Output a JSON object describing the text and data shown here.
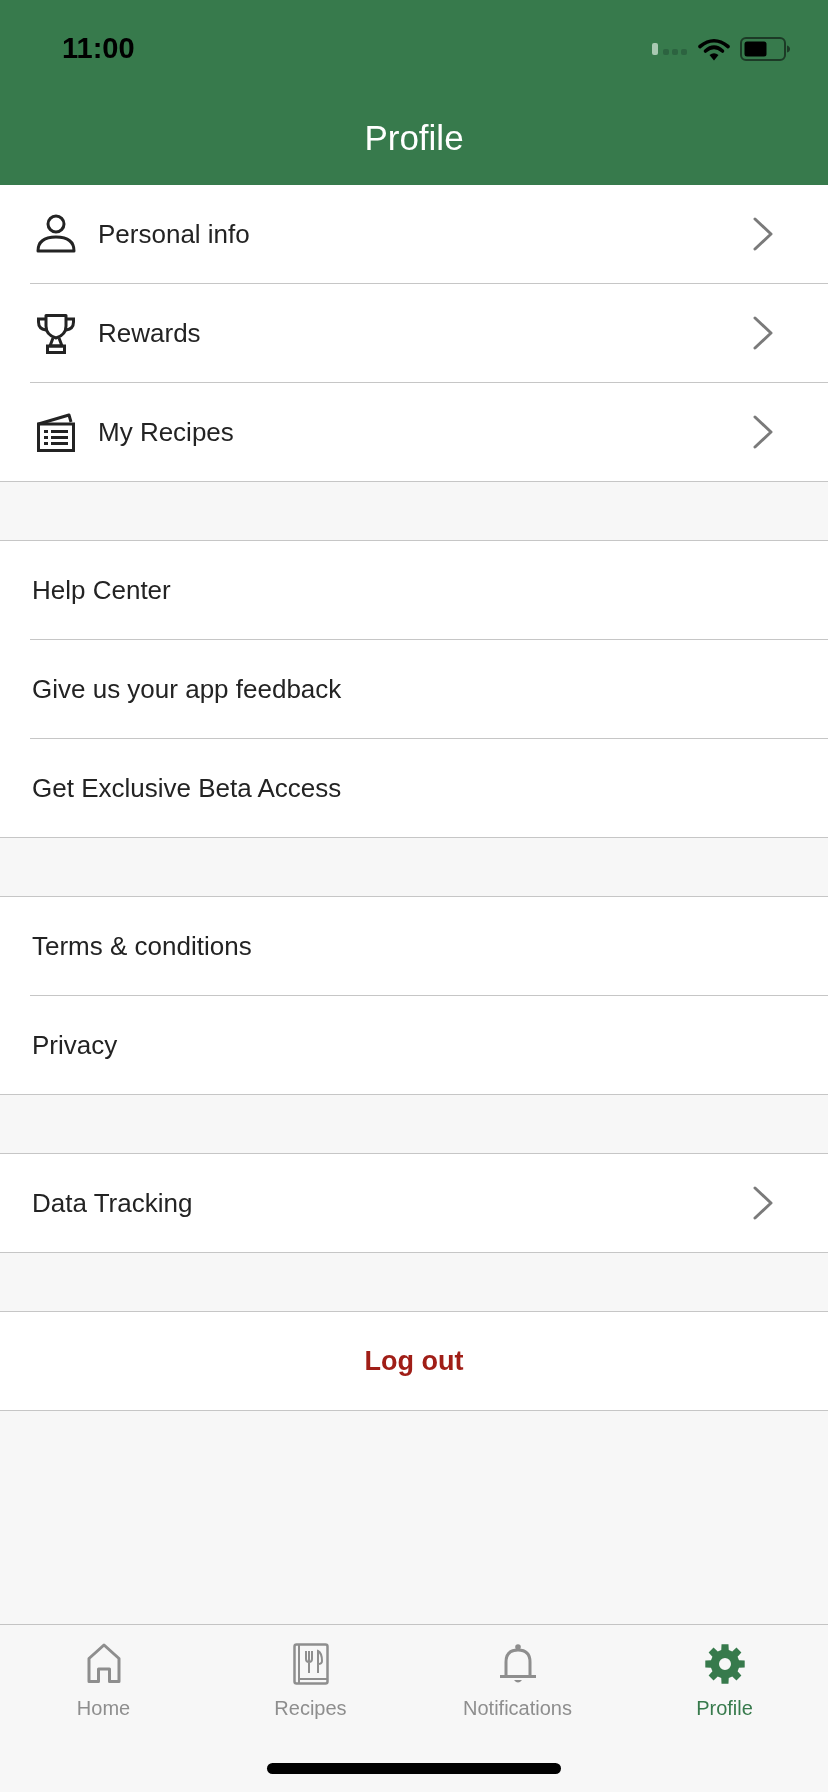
{
  "status_bar": {
    "time": "11:00"
  },
  "header": {
    "title": "Profile"
  },
  "sections": [
    {
      "items": [
        {
          "label": "Personal info",
          "kind": "icon"
        },
        {
          "label": "Rewards",
          "kind": "icon"
        },
        {
          "label": "My Recipes",
          "kind": "icon"
        }
      ]
    },
    {
      "items": [
        {
          "label": "Help Center",
          "kind": "plain"
        },
        {
          "label": "Give us your app feedback",
          "kind": "plain"
        },
        {
          "label": "Get Exclusive Beta Access",
          "kind": "plain"
        }
      ]
    },
    {
      "items": [
        {
          "label": "Terms & conditions",
          "kind": "plain"
        },
        {
          "label": "Privacy",
          "kind": "plain"
        }
      ]
    },
    {
      "items": [
        {
          "label": "Data Tracking",
          "kind": "link"
        }
      ]
    }
  ],
  "logout_button": {
    "label": "Log out"
  },
  "tabs": [
    {
      "label": "Home",
      "selected": false
    },
    {
      "label": "Recipes",
      "selected": false
    },
    {
      "label": "Notifications",
      "selected": false
    },
    {
      "label": "Profile",
      "selected": true
    }
  ]
}
